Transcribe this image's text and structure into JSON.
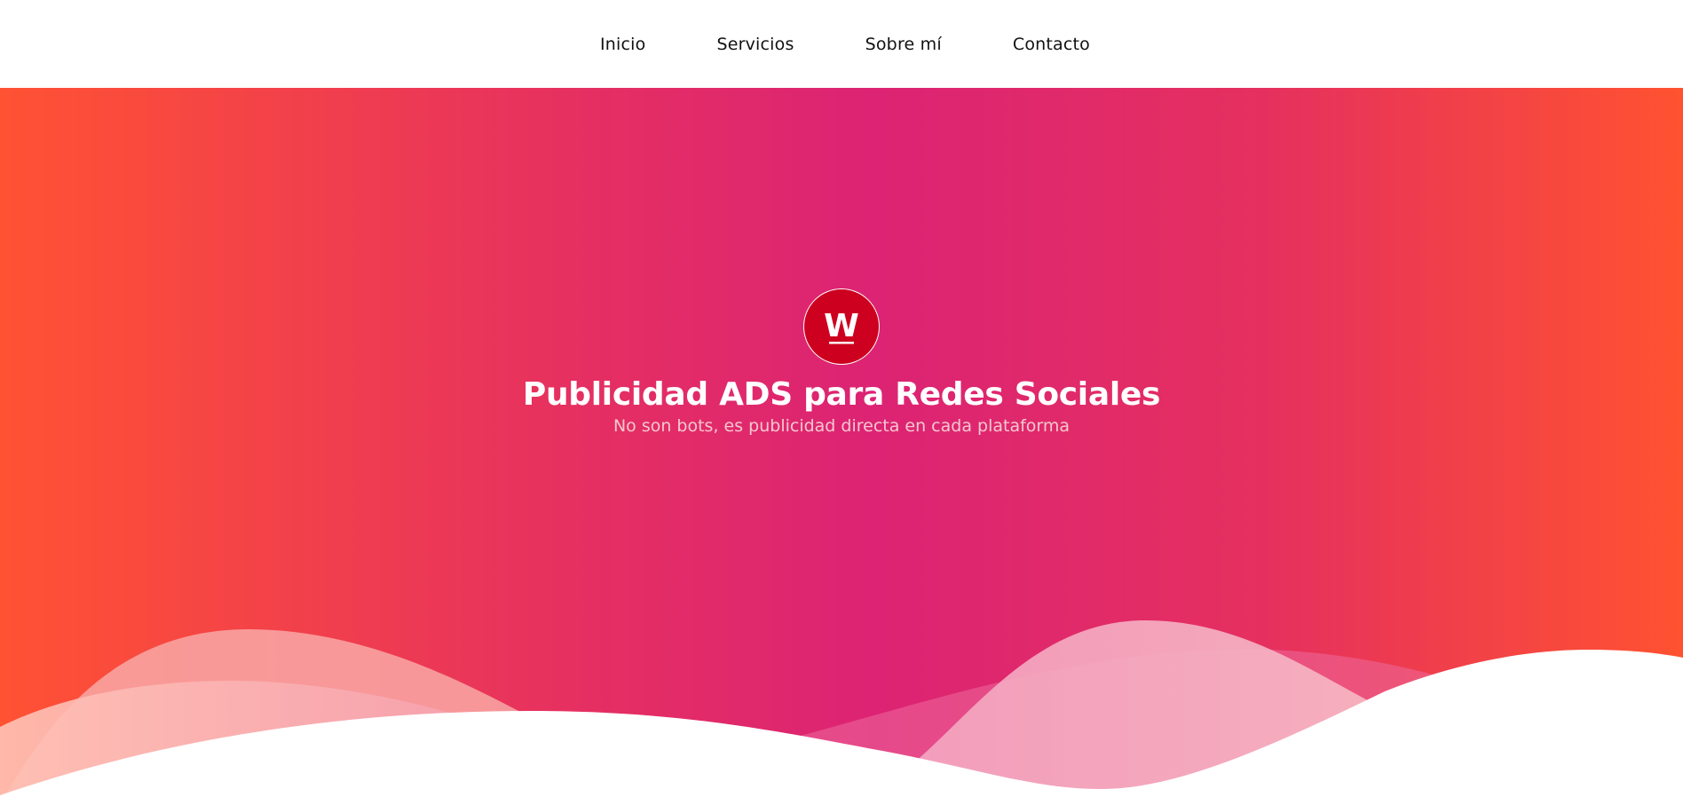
{
  "nav": {
    "items": [
      {
        "label": "Inicio"
      },
      {
        "label": "Servicios"
      },
      {
        "label": "Sobre mí"
      },
      {
        "label": "Contacto"
      }
    ]
  },
  "hero": {
    "logo_letter": "W",
    "title": "Publicidad ADS para Redes Sociales",
    "subtitle": "No son bots, es publicidad directa en cada plataforma"
  },
  "colors": {
    "gradient_edge": "#ff5233",
    "gradient_center": "#dc2374",
    "logo_background": "#cd011f",
    "text_primary": "#ffffff",
    "nav_text": "#111111"
  }
}
